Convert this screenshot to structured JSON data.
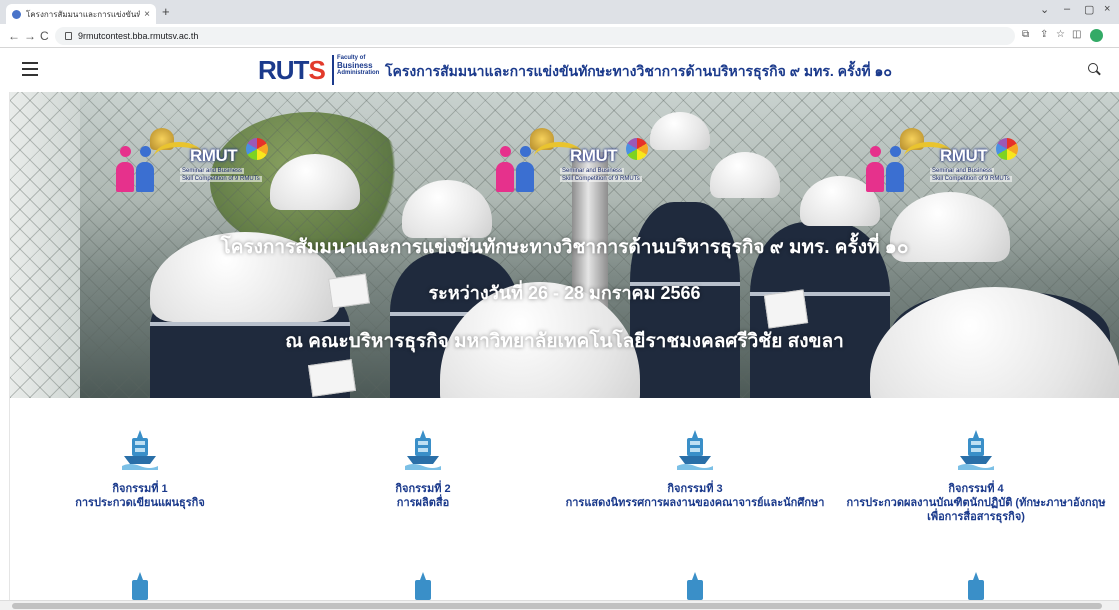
{
  "browser": {
    "tab_title": "โครงการสัมมนาและการแข่งขันทักษะ",
    "tab_close": "×",
    "new_tab": "+",
    "url": "9rmutcontest.bba.rmutsv.ac.th",
    "back": "←",
    "forward": "→",
    "reload": "C",
    "minimize": "–",
    "restore": "▢",
    "close": "×",
    "chevron": "⌄",
    "share": "⇪",
    "star": "☆",
    "sidepanel": "◫"
  },
  "header": {
    "logo_ruts_a": "RUT",
    "logo_ruts_b": "S",
    "logo_fac_1": "Faculty of",
    "logo_fac_2": "Business",
    "logo_fac_3": "Administration",
    "site_title": "โครงการสัมมนาและการแข่งขันทักษะทางวิชาการด้านบริหารธุรกิจ ๙ มทร. ครั้งที่ ๑๐"
  },
  "hero": {
    "emblem_name": "RMUT",
    "emblem_sub1": "Seminar and Business",
    "emblem_sub2": "Skill Competition of 9 RMUTs",
    "line1": "โครงการสัมมนาและการแข่งขันทักษะทางวิชาการด้านบริหารธุรกิจ ๙ มทร. ครั้งที่ ๑๐",
    "line2": "ระหว่างวันที่ 26 - 28 มกราคม 2566",
    "line3": "ณ คณะบริหารธุรกิจ มหาวิทยาลัยเทคโนโลยีราชมงคลศรีวิชัย สงขลา"
  },
  "activities": [
    {
      "num": "กิจกรรมที่ 1",
      "desc": "การประกวดเขียนแผนธุรกิจ"
    },
    {
      "num": "กิจกรรมที่ 2",
      "desc": "การผลิตสื่อ"
    },
    {
      "num": "กิจกรรมที่ 3",
      "desc": "การแสดงนิทรรศการผลงานของคณาจารย์และนักศึกษา"
    },
    {
      "num": "กิจกรรมที่ 4",
      "desc": "การประกวดผลงานบัณฑิตนักปฏิบัติ (ทักษะภาษาอังกฤษเพื่อการสื่อสารธุรกิจ)"
    }
  ],
  "colors": {
    "brand_blue": "#1b3a8c",
    "brand_red": "#e23a2b"
  }
}
